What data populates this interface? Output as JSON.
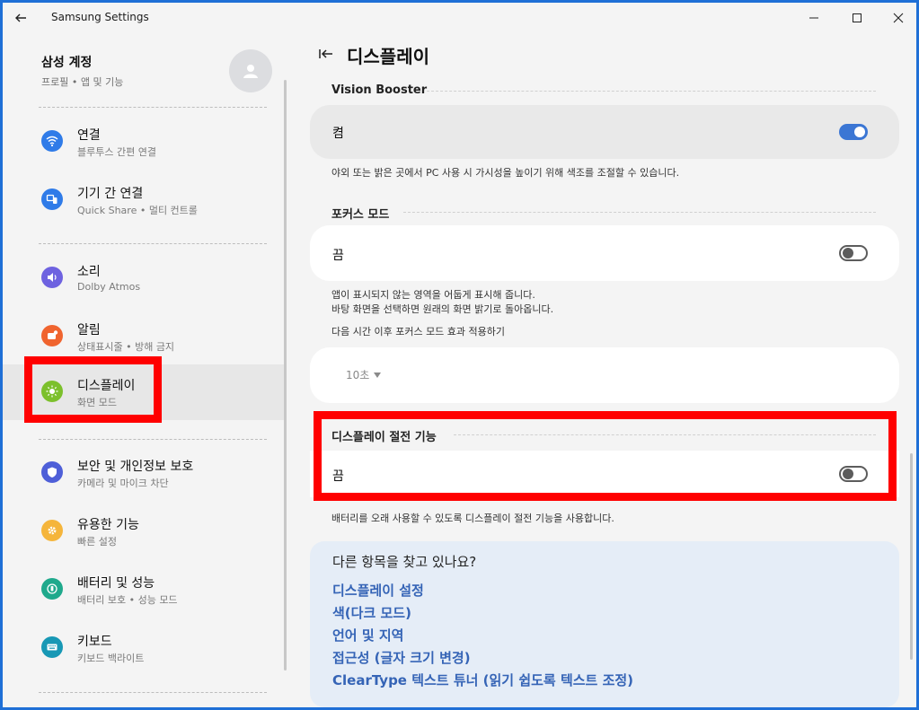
{
  "window": {
    "title": "Samsung Settings"
  },
  "profile": {
    "name": "삼성 계정",
    "sub": "프로필 • 앱 및 기능"
  },
  "sidebar": {
    "items": [
      {
        "label": "연결",
        "sub": "블루투스 간편 연결",
        "icon": "wifi-icon",
        "color": "#2f7be8"
      },
      {
        "label": "기기 간 연결",
        "sub": "Quick Share  •  멀티 컨트롤",
        "icon": "devices-icon",
        "color": "#2f7be8"
      },
      {
        "label": "소리",
        "sub": "Dolby Atmos",
        "icon": "speaker-icon",
        "color": "#6e62e0"
      },
      {
        "label": "알림",
        "sub": "상태표시줄  •  방해 금지",
        "icon": "notification-icon",
        "color": "#f0642f"
      },
      {
        "label": "디스플레이",
        "sub": "화면 모드",
        "icon": "brightness-icon",
        "color": "#7cc02c"
      },
      {
        "label": "보안 및 개인정보 보호",
        "sub": "카메라 및 마이크 차단",
        "icon": "shield-icon",
        "color": "#4e5fd8"
      },
      {
        "label": "유용한 기능",
        "sub": "빠른 설정",
        "icon": "gear-icon",
        "color": "#f5b53b"
      },
      {
        "label": "배터리 및 성능",
        "sub": "배터리 보호  •  성능 모드",
        "icon": "battery-icon",
        "color": "#1fa98c"
      },
      {
        "label": "키보드",
        "sub": "키보드 백라이트",
        "icon": "keyboard-icon",
        "color": "#1798b5"
      }
    ]
  },
  "main": {
    "title": "디스플레이",
    "vision_booster": {
      "header": "Vision Booster",
      "label": "켬",
      "state": "on",
      "desc": "야외 또는 밝은 곳에서 PC 사용 시 가시성을 높이기 위해 색조를 조절할 수 있습니다."
    },
    "focus_mode": {
      "header": "포커스 모드",
      "label": "끔",
      "state": "off",
      "desc1": "앱이 표시되지 않는 영역을 어둡게 표시해 줍니다.",
      "desc2": "바탕 화면을 선택하면 원래의 화면 밝기로 돌아옵니다.",
      "desc3": "다음 시간 이후 포커스 모드 효과 적용하기",
      "dropdown_value": "10초"
    },
    "power_saving": {
      "header": "디스플레이 절전 기능",
      "label": "끔",
      "state": "off",
      "desc": "배터리를 오래 사용할 수 있도록 디스플레이 절전 기능을 사용합니다."
    },
    "help": {
      "title": "다른 항목을 찾고 있나요?",
      "links": [
        "디스플레이 설정",
        "색(다크 모드)",
        "언어 및 지역",
        "접근성 (글자 크기 변경)",
        "ClearType 텍스트 튜너 (읽기 쉽도록 텍스트 조정)"
      ]
    }
  },
  "colors": {
    "accent": "#3b76d4",
    "highlight": "#ff0000",
    "link": "#3564b6"
  }
}
